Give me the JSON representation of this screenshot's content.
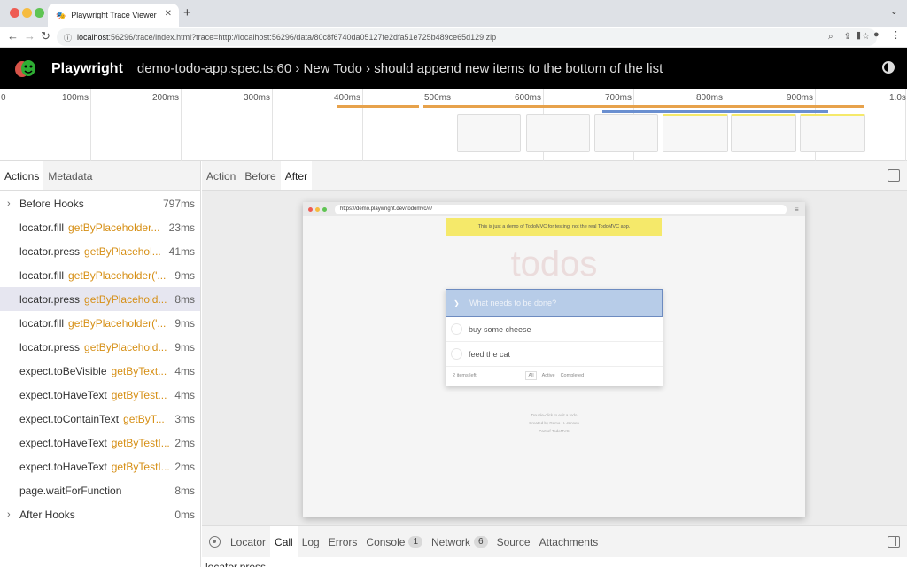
{
  "browser": {
    "tab_title": "Playwright Trace Viewer",
    "url_host": "localhost",
    "url_rest": ":56296/trace/index.html?trace=http://localhost:56296/data/80c8f6740da05127fe2dfa51e725b489ce65d129.zip"
  },
  "app": {
    "brand": "Playwright",
    "title": "demo-todo-app.spec.ts:60 › New Todo › should append new items to the bottom of the list"
  },
  "timeline": {
    "ticks": [
      "0",
      "100ms",
      "200ms",
      "300ms",
      "400ms",
      "500ms",
      "600ms",
      "700ms",
      "800ms",
      "900ms",
      "1.0s"
    ]
  },
  "sidebar": {
    "tabs": [
      "Actions",
      "Metadata"
    ],
    "actions": [
      {
        "method": "Before Hooks",
        "locator": "",
        "duration": "797ms",
        "expandable": true
      },
      {
        "method": "locator.fill",
        "locator": "getByPlaceholder...",
        "duration": "23ms"
      },
      {
        "method": "locator.press",
        "locator": "getByPlacehol...",
        "duration": "41ms"
      },
      {
        "method": "locator.fill",
        "locator": "getByPlaceholder('...",
        "duration": "9ms"
      },
      {
        "method": "locator.press",
        "locator": "getByPlacehold...",
        "duration": "8ms",
        "selected": true
      },
      {
        "method": "locator.fill",
        "locator": "getByPlaceholder('...",
        "duration": "9ms"
      },
      {
        "method": "locator.press",
        "locator": "getByPlacehold...",
        "duration": "9ms"
      },
      {
        "method": "expect.toBeVisible",
        "locator": "getByText...",
        "duration": "4ms"
      },
      {
        "method": "expect.toHaveText",
        "locator": "getByTest...",
        "duration": "4ms"
      },
      {
        "method": "expect.toContainText",
        "locator": "getByT...",
        "duration": "3ms"
      },
      {
        "method": "expect.toHaveText",
        "locator": "getByTestI...",
        "duration": "2ms"
      },
      {
        "method": "expect.toHaveText",
        "locator": "getByTestI...",
        "duration": "2ms"
      },
      {
        "method": "page.waitForFunction",
        "locator": "",
        "duration": "8ms"
      },
      {
        "method": "After Hooks",
        "locator": "",
        "duration": "0ms",
        "expandable": true
      }
    ]
  },
  "main": {
    "tabs": [
      "Action",
      "Before",
      "After"
    ],
    "selected_tab": "After"
  },
  "snapshot": {
    "url": "https://demo.playwright.dev/todomvc/#/",
    "banner": "This is just a demo of TodoMVC for testing, not the real TodoMVC app.",
    "heading": "todos",
    "new_todo_placeholder": "What needs to be done?",
    "items": [
      "buy some cheese",
      "feed the cat"
    ],
    "items_left": "2 items left",
    "filters": [
      "All",
      "Active",
      "Completed"
    ],
    "info": [
      "Double-click to edit a todo",
      "Created by Remo H. Jansen",
      "Part of TodoMVC"
    ]
  },
  "bottom": {
    "tabs": [
      {
        "label": "Locator"
      },
      {
        "label": "Call",
        "selected": true
      },
      {
        "label": "Log"
      },
      {
        "label": "Errors"
      },
      {
        "label": "Console",
        "badge": "1"
      },
      {
        "label": "Network",
        "badge": "6"
      },
      {
        "label": "Source"
      },
      {
        "label": "Attachments"
      }
    ],
    "peek_text": "locator.press"
  },
  "colors": {
    "header_bg": "#000000",
    "locator_text": "#d68f15",
    "selected_row": "#e6e6f0",
    "timeline_orange": "#e7a24b",
    "timeline_blue": "#6a8fd0",
    "banner_yellow": "#f5e96a"
  }
}
